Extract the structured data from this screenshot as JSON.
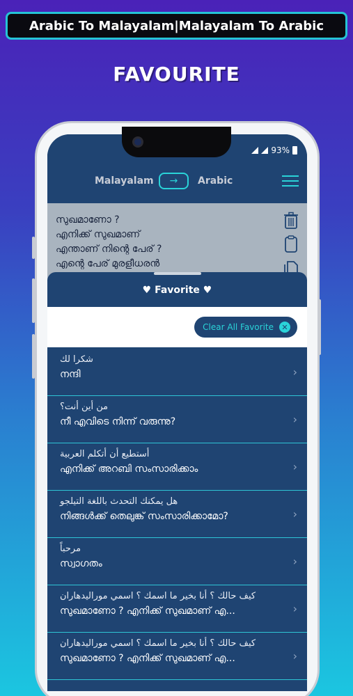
{
  "banner": {
    "title": "Arabic To Malayalam|Malayalam To Arabic"
  },
  "promo": {
    "title": "FAVOURITE"
  },
  "status": {
    "battery": "93%"
  },
  "header": {
    "from_lang": "Malayalam",
    "to_lang": "Arabic",
    "swap_glyph": "→"
  },
  "input": {
    "lines": [
      "സുഖമാണോ ?",
      "എനിക്ക് സുഖമാണ്",
      "എന്താണ് നിന്റെ പേര് ?",
      "എന്റെ പേര് മുരളീധരൻ"
    ]
  },
  "sheet": {
    "title": "♥ Favorite ♥",
    "clear_label": "Clear All Favorite",
    "clear_icon": "✕"
  },
  "favorites": [
    {
      "arabic": "شكرا لك",
      "malayalam": "നന്ദി"
    },
    {
      "arabic": "من أين أنت؟",
      "malayalam": "നീ എവിടെ നിന്ന് വരുന്നു?"
    },
    {
      "arabic": "أستطيع أن أتكلم العربية",
      "malayalam": "എനിക്ക് അറബി സംസാരിക്കാം"
    },
    {
      "arabic": "هل يمكنك التحدث باللغة التيلجو",
      "malayalam": "നിങ്ങൾക്ക് തെലുങ്ക് സംസാരിക്കാമോ?"
    },
    {
      "arabic": "مرحباً",
      "malayalam": "സ്വാഗതം"
    },
    {
      "arabic": "كيف حالك ؟ أنا بخير ما اسمك ؟ اسمي موراليدهاران",
      "malayalam": "സുഖമാണോ ? എനിക്ക് സുഖമാണ് എ..."
    },
    {
      "arabic": "كيف حالك ؟ أنا بخير ما اسمك ؟ اسمي موراليدهاران",
      "malayalam": "സുഖമാണോ ? എനിക്ക് സുഖമാണ് എ..."
    }
  ],
  "icons": {
    "swap": "arrow-right-icon",
    "menu": "hamburger-menu-icon",
    "delete": "trash-icon",
    "copy": "clipboard-icon",
    "paste": "documents-icon",
    "chevron": "chevron-right-icon"
  }
}
